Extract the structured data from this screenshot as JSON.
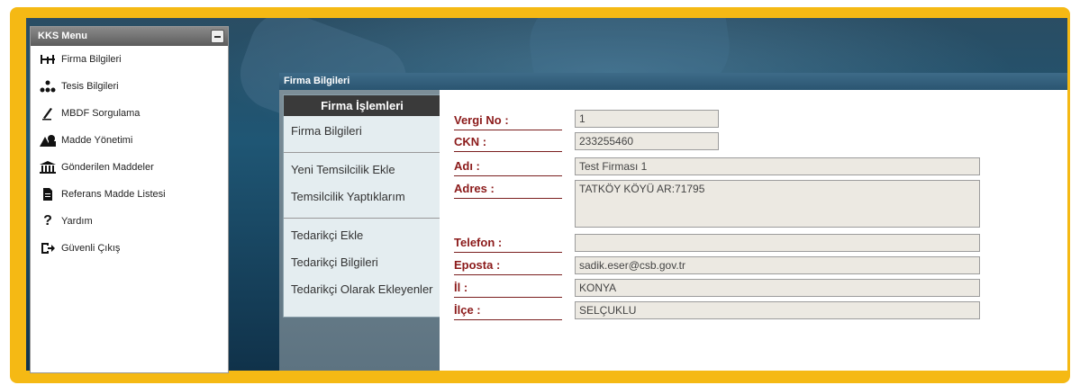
{
  "menu": {
    "title": "KKS Menu",
    "items": [
      {
        "label": "Firma Bilgileri",
        "icon": "organization-chart-icon"
      },
      {
        "label": "Tesis Bilgileri",
        "icon": "hierarchy-icon"
      },
      {
        "label": "MBDF Sorgulama",
        "icon": "pen-icon"
      },
      {
        "label": "Madde Yönetimi",
        "icon": "shapes-icon"
      },
      {
        "label": "Gönderilen Maddeler",
        "icon": "bank-icon"
      },
      {
        "label": "Referans Madde Listesi",
        "icon": "document-icon"
      },
      {
        "label": "Yardım",
        "icon": "question-icon"
      },
      {
        "label": "Güvenli Çıkış",
        "icon": "logout-icon"
      }
    ]
  },
  "window": {
    "title": "Firma Bilgileri",
    "ops_title": "Firma İşlemleri",
    "ops_group1": [
      "Firma Bilgileri"
    ],
    "ops_group2": [
      "Yeni Temsilcilik Ekle",
      "Temsilcilik Yaptıklarım"
    ],
    "ops_group3": [
      "Tedarikçi Ekle",
      "Tedarikçi Bilgileri",
      "Tedarikçi Olarak Ekleyenler"
    ]
  },
  "form": {
    "vergi_label": "Vergi No :",
    "vergi_value": "1",
    "ckn_label": "CKN :",
    "ckn_value": "233255460",
    "adi_label": "Adı :",
    "adi_value": "Test Firması 1",
    "adres_label": "Adres :",
    "adres_value": "TATKÖY KÖYÜ AR:71795",
    "telefon_label": "Telefon :",
    "telefon_value": "",
    "eposta_label": "Eposta :",
    "eposta_value": "sadik.eser@csb.gov.tr",
    "il_label": "İl :",
    "il_value": "KONYA",
    "ilce_label": "İlçe :",
    "ilce_value": "SELÇUKLU"
  },
  "colors": {
    "highlight_border": "#f5b914",
    "label_red": "#8b1a1a",
    "title_bar": "#2f5a76"
  }
}
